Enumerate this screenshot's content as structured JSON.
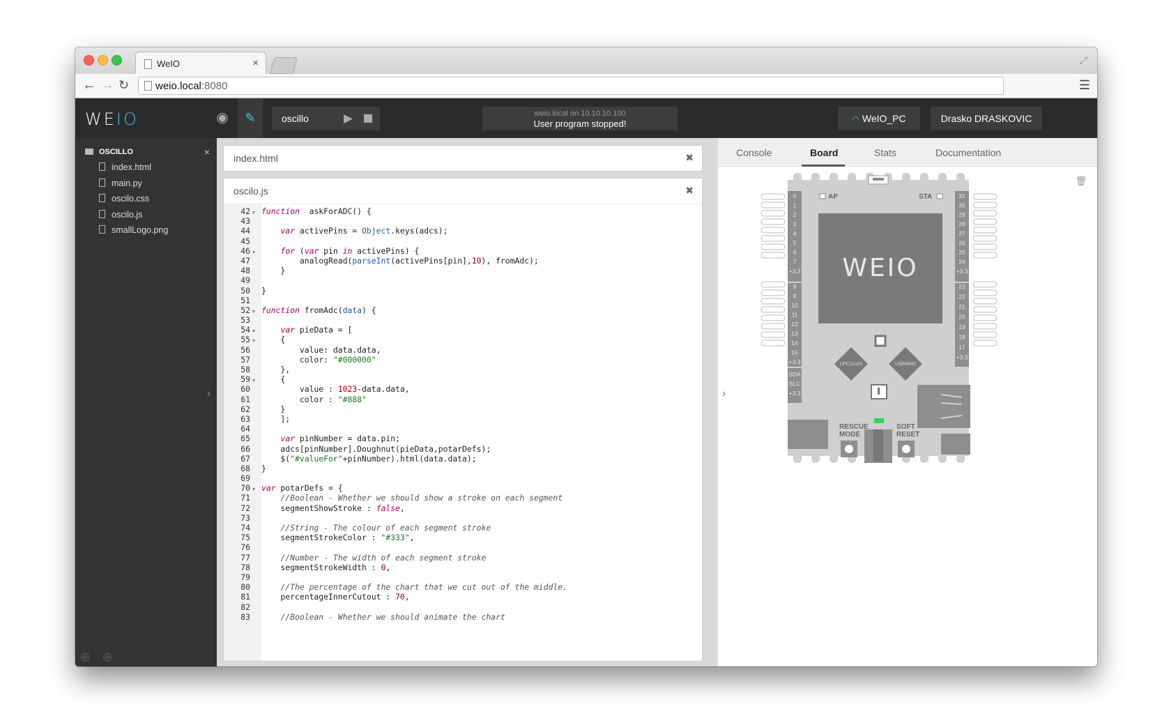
{
  "browser": {
    "tab_title": "WeIO",
    "url_host": "weio.local",
    "url_port": ":8080"
  },
  "header": {
    "logo_text": "WE",
    "logo_accent": "IO",
    "project_name": "oscillo",
    "status_host": "weio.local on 10.10.10.100",
    "status_message": "User program stopped!",
    "wifi_name": "WeIO_PC",
    "user_name": "Drasko DRASKOVIC"
  },
  "sidebar": {
    "project_title": "OSCILLO",
    "files": [
      "index.html",
      "main.py",
      "oscilo.css",
      "oscilo.js",
      "smallLogo.png"
    ]
  },
  "editor": {
    "tab1_name": "index.html",
    "tab2_name": "oscilo.js",
    "lines": [
      {
        "n": "42",
        "f": true,
        "t": [
          [
            "kw",
            "function"
          ],
          [
            "",
            "  askForADC() {"
          ]
        ]
      },
      {
        "n": "43",
        "t": []
      },
      {
        "n": "44",
        "t": [
          [
            "",
            "    "
          ],
          [
            "kw",
            "var"
          ],
          [
            "",
            " activePins = "
          ],
          [
            "bi",
            "Object"
          ],
          [
            "",
            ".keys(adcs);"
          ]
        ]
      },
      {
        "n": "45",
        "t": []
      },
      {
        "n": "46",
        "f": true,
        "t": [
          [
            "",
            "    "
          ],
          [
            "kw",
            "for"
          ],
          [
            "",
            " ("
          ],
          [
            "kw",
            "var"
          ],
          [
            "",
            " pin "
          ],
          [
            "kw",
            "in"
          ],
          [
            "",
            " activePins) {"
          ]
        ]
      },
      {
        "n": "47",
        "t": [
          [
            "",
            "        analogRead("
          ],
          [
            "bi",
            "parseInt"
          ],
          [
            "",
            "(activePins[pin],"
          ],
          [
            "num",
            "10"
          ],
          [
            "",
            "), fromAdc);"
          ]
        ]
      },
      {
        "n": "48",
        "t": [
          [
            "",
            "    }"
          ]
        ]
      },
      {
        "n": "49",
        "t": []
      },
      {
        "n": "50",
        "t": [
          [
            "",
            "}"
          ]
        ]
      },
      {
        "n": "51",
        "t": []
      },
      {
        "n": "52",
        "f": true,
        "t": [
          [
            "kw",
            "function"
          ],
          [
            "",
            " fromAdc("
          ],
          [
            "bi",
            "data"
          ],
          [
            "",
            ") {"
          ]
        ]
      },
      {
        "n": "53",
        "t": []
      },
      {
        "n": "54",
        "f": true,
        "t": [
          [
            "",
            "    "
          ],
          [
            "kw",
            "var"
          ],
          [
            "",
            " pieData = ["
          ]
        ]
      },
      {
        "n": "55",
        "f": true,
        "t": [
          [
            "",
            "    {"
          ]
        ]
      },
      {
        "n": "56",
        "t": [
          [
            "",
            "        value: data.data,"
          ]
        ]
      },
      {
        "n": "57",
        "t": [
          [
            "",
            "        color: "
          ],
          [
            "str",
            "\"#000000\""
          ]
        ]
      },
      {
        "n": "58",
        "t": [
          [
            "",
            "    },"
          ]
        ]
      },
      {
        "n": "59",
        "f": true,
        "t": [
          [
            "",
            "    {"
          ]
        ]
      },
      {
        "n": "60",
        "t": [
          [
            "",
            "        value : "
          ],
          [
            "num",
            "1023"
          ],
          [
            "",
            "-data.data,"
          ]
        ]
      },
      {
        "n": "61",
        "t": [
          [
            "",
            "        color : "
          ],
          [
            "str",
            "\"#888\""
          ]
        ]
      },
      {
        "n": "62",
        "t": [
          [
            "",
            "    }"
          ]
        ]
      },
      {
        "n": "63",
        "t": [
          [
            "",
            "    ];"
          ]
        ]
      },
      {
        "n": "64",
        "t": []
      },
      {
        "n": "65",
        "t": [
          [
            "",
            "    "
          ],
          [
            "kw",
            "var"
          ],
          [
            "",
            " pinNumber = data.pin;"
          ]
        ]
      },
      {
        "n": "66",
        "t": [
          [
            "",
            "    adcs[pinNumber].Doughnut(pieData,potarDefs);"
          ]
        ]
      },
      {
        "n": "67",
        "t": [
          [
            "",
            "    $("
          ],
          [
            "str",
            "\"#valueFor\""
          ],
          [
            "",
            "+pinNumber).html(data.data);"
          ]
        ]
      },
      {
        "n": "68",
        "t": [
          [
            "",
            "}"
          ]
        ]
      },
      {
        "n": "69",
        "t": []
      },
      {
        "n": "70",
        "f": true,
        "t": [
          [
            "kw",
            "var"
          ],
          [
            "",
            " potarDefs = {"
          ]
        ]
      },
      {
        "n": "71",
        "t": [
          [
            "",
            "    "
          ],
          [
            "cm",
            "//Boolean - Whether we should show a stroke on each segment"
          ]
        ]
      },
      {
        "n": "72",
        "t": [
          [
            "",
            "    segmentShowStroke : "
          ],
          [
            "kw",
            "false"
          ],
          [
            "",
            ","
          ]
        ]
      },
      {
        "n": "73",
        "t": []
      },
      {
        "n": "74",
        "t": [
          [
            "",
            "    "
          ],
          [
            "cm",
            "//String - The colour of each segment stroke"
          ]
        ]
      },
      {
        "n": "75",
        "t": [
          [
            "",
            "    segmentStrokeColor : "
          ],
          [
            "str",
            "\"#333\""
          ],
          [
            "",
            ","
          ]
        ]
      },
      {
        "n": "76",
        "t": []
      },
      {
        "n": "77",
        "t": [
          [
            "",
            "    "
          ],
          [
            "cm",
            "//Number - The width of each segment stroke"
          ]
        ]
      },
      {
        "n": "78",
        "t": [
          [
            "",
            "    segmentStrokeWidth : "
          ],
          [
            "num",
            "0"
          ],
          [
            "",
            ","
          ]
        ]
      },
      {
        "n": "79",
        "t": []
      },
      {
        "n": "80",
        "t": [
          [
            "",
            "    "
          ],
          [
            "cm",
            "//The percentage of the chart that we cut out of the middle."
          ]
        ]
      },
      {
        "n": "81",
        "t": [
          [
            "",
            "    percentageInnerCutout : "
          ],
          [
            "num",
            "70"
          ],
          [
            "",
            ","
          ]
        ]
      },
      {
        "n": "82",
        "t": []
      },
      {
        "n": "83",
        "t": [
          [
            "",
            "    "
          ],
          [
            "cm",
            "//Boolean - Whether we should animate the chart"
          ]
        ]
      }
    ]
  },
  "right_panel": {
    "tabs": [
      "Console",
      "Board",
      "Stats",
      "Documentation"
    ],
    "active_tab": "Board",
    "board": {
      "logo": "WEIO",
      "label_ap": "AP",
      "label_sta": "STA",
      "left_pins_top": [
        "0",
        "1",
        "2",
        "3",
        "4",
        "5",
        "6",
        "7",
        "+3.3"
      ],
      "left_pins_mid": [
        "8",
        "9",
        "10",
        "11",
        "12",
        "13",
        "14",
        "15",
        "+3.3"
      ],
      "left_pins_bottom": [
        "SDA",
        "SLC",
        "+3.3"
      ],
      "right_pins_top": [
        "31",
        "30",
        "29",
        "28",
        "27",
        "26",
        "25",
        "24",
        "+3.3"
      ],
      "right_pins_mid": [
        "23",
        "22",
        "21",
        "20",
        "19",
        "18",
        "17",
        "+3.3"
      ],
      "chip1": "LPC11u24",
      "chip2": "USB4640",
      "rescue_line1": "RESCUE",
      "rescue_line2": "MODE",
      "soft_line1": "SOFT",
      "soft_line2": "RESET"
    }
  },
  "colors": {
    "accent": "#3ec4e8",
    "led": "#39d353",
    "board_gray": "#cfcfcf"
  }
}
